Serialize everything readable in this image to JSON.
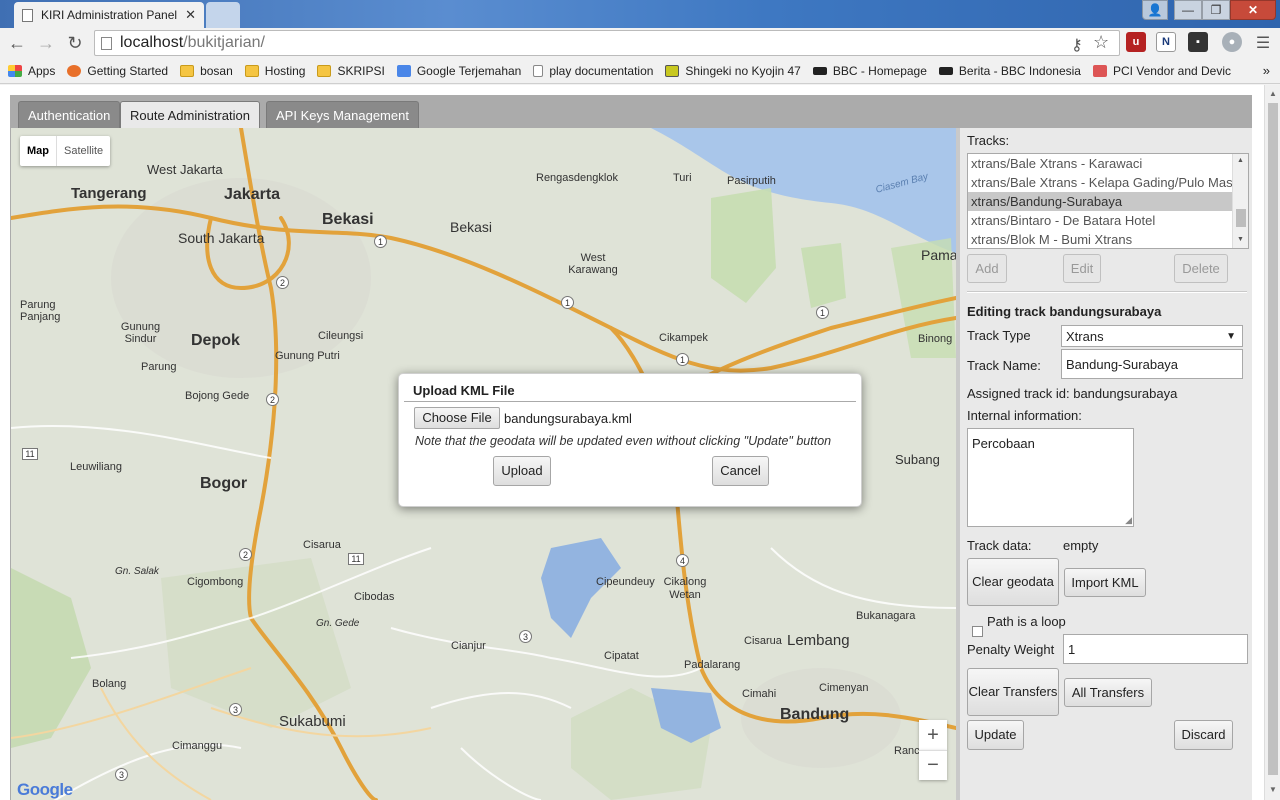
{
  "browser": {
    "tabs": [
      {
        "title": "KIRI Administration Panel",
        "close": "✕"
      }
    ],
    "window_controls": {
      "minimize": "—",
      "maximize": "❐",
      "close": "✕"
    },
    "url_host": "localhost",
    "url_path": "/bukitjarian/",
    "bookmarks": [
      "Apps",
      "Getting Started",
      "bosan",
      "Hosting",
      "SKRIPSI",
      "Google Terjemahan",
      "play documentation",
      "Shingeki no Kyojin 47",
      "BBC - Homepage",
      "Berita - BBC Indonesia",
      "PCI Vendor and Devic"
    ],
    "bookmarks_more": "»"
  },
  "app": {
    "tabs": [
      "Authentication",
      "Route Administration",
      "API Keys Management"
    ],
    "active_tab": "Route Administration"
  },
  "map": {
    "type_map": "Map",
    "type_satellite": "Satellite",
    "zoom_in": "+",
    "zoom_out": "−",
    "google": "Google",
    "places": [
      "West Jakarta",
      "Jakarta",
      "Tangerang",
      "Bekasi",
      "Bekasi",
      "South Jakarta",
      "Rengasdengklok",
      "Turi",
      "Pasirputih",
      "Ciasem Bay",
      "West Karawang",
      "Pama",
      "Parung Panjang",
      "Gunung Sindur",
      "Depok",
      "Cileungsi",
      "Gunung Putri",
      "Cikampek",
      "Binong",
      "Parung",
      "Bojong Gede",
      "Subang",
      "Leuwiliang",
      "Bogor",
      "Cisarua",
      "Gn. Salak",
      "Cigombong",
      "Cibodas",
      "Cipeundeuy",
      "Cikalong Wetan",
      "Bukanagara",
      "Gn. Gede",
      "Cianjur",
      "Cisarua",
      "Lembang",
      "Cipatat",
      "Padalarang",
      "Cimenyan",
      "Bolang",
      "Cimahi",
      "Sukabumi",
      "Bandung",
      "Cimanggu",
      "Ranc"
    ],
    "route_shields": [
      "1",
      "1",
      "1",
      "1",
      "1",
      "2",
      "2",
      "2",
      "2",
      "2",
      "3",
      "3",
      "3",
      "3",
      "4",
      "11",
      "11"
    ]
  },
  "sidebar": {
    "tracks_label": "Tracks:",
    "tracks": [
      "xtrans/Bale Xtrans - Karawaci",
      "xtrans/Bale Xtrans - Kelapa Gading/Pulo Mas",
      "xtrans/Bandung-Surabaya",
      "xtrans/Bintaro - De Batara Hotel",
      "xtrans/Blok M - Bumi Xtrans"
    ],
    "selected_track": "xtrans/Bandung-Surabaya",
    "add": "Add",
    "edit": "Edit",
    "delete": "Delete",
    "editing_title": "Editing track bandungsurabaya",
    "track_type_label": "Track Type",
    "track_type_value": "Xtrans",
    "track_name_label": "Track Name:",
    "track_name_value": "Bandung-Surabaya",
    "assigned_id": "Assigned track id: bandungsurabaya",
    "internal_info_label": "Internal information:",
    "internal_info_value": "Percobaan",
    "track_data_label": "Track data:",
    "track_data_value": "empty",
    "clear_geodata": "Clear geodata",
    "import_kml": "Import KML",
    "loop_label": "Path is a loop",
    "penalty_label": "Penalty Weight",
    "penalty_value": "1",
    "clear_transfers": "Clear Transfers",
    "all_transfers": "All Transfers",
    "update": "Update",
    "discard": "Discard"
  },
  "modal": {
    "title": "Upload KML File",
    "choose_file": "Choose File",
    "file_name": "bandungsurabaya.kml",
    "note": "Note that the geodata will be updated even without clicking \"Update\" button",
    "upload": "Upload",
    "cancel": "Cancel"
  },
  "colors": {
    "highway": "#e6a33a",
    "water": "#a7c5e8",
    "park": "#c6dcb2",
    "land": "#e2e5d9"
  }
}
